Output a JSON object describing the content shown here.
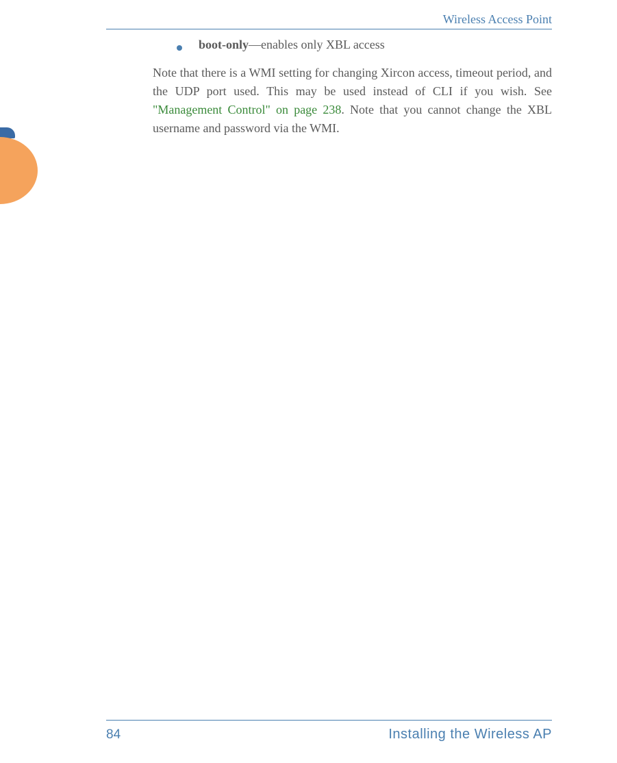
{
  "header": {
    "title": "Wireless Access Point"
  },
  "content": {
    "bullet": {
      "term": "boot-only",
      "sep": "—",
      "desc": "enables only XBL access"
    },
    "para": {
      "pre": "Note that there is a WMI setting for changing Xircon access, timeout period, and the UDP port used. This may be used instead of CLI if you wish. See ",
      "link": "\"Management Control\" on page 238",
      "post": ". Note that you cannot change the XBL username and password via the WMI."
    }
  },
  "footer": {
    "page": "84",
    "section": "Installing the Wireless AP"
  }
}
